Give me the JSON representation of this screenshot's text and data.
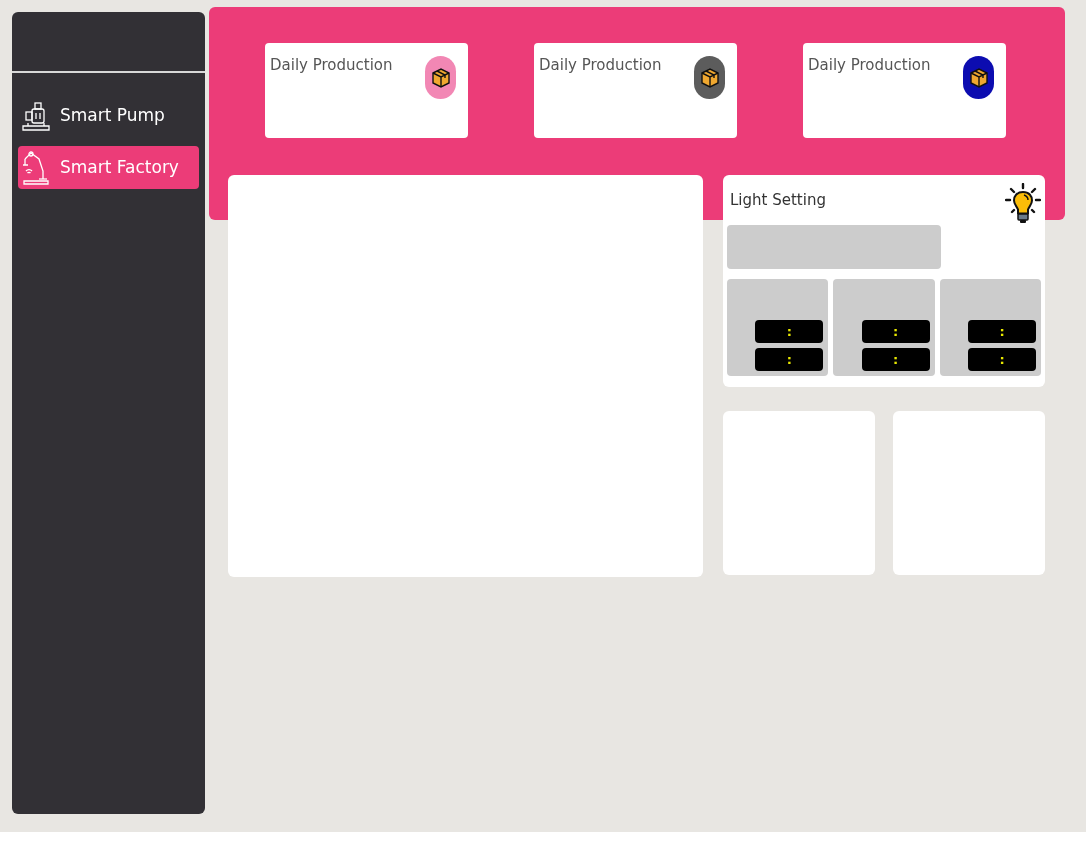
{
  "sidebar": {
    "items": [
      {
        "label": "Smart Pump",
        "kind": "pump",
        "selected": false
      },
      {
        "label": "Smart Factory",
        "kind": "factory",
        "selected": true
      }
    ]
  },
  "stat_cards": [
    {
      "title": "Daily Production",
      "color": "#f287b4"
    },
    {
      "title": "Daily Production",
      "color": "#5c5c5c"
    },
    {
      "title": "Daily Production",
      "color": "#0c0cb0"
    }
  ],
  "light_setting": {
    "title": "Light Setting",
    "timers": [
      {
        "start": ":",
        "end": ":"
      },
      {
        "start": ":",
        "end": ":"
      },
      {
        "start": ":",
        "end": ":"
      }
    ]
  }
}
